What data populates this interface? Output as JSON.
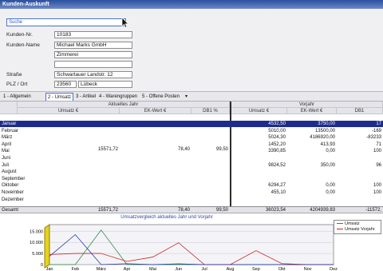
{
  "window": {
    "title": "Kunden-Auskunft"
  },
  "search": {
    "label": "Suche"
  },
  "customer": {
    "nr_label": "Kunden-Nr.",
    "nr": "10183",
    "name_label": "Kunden-Name",
    "name1": "Michael Marks GmbH",
    "name2": "Zimmerei",
    "street_label": "Straße",
    "street": "Schwartauer Landstr. 12",
    "city_label": "PLZ / Ort",
    "zip": "23560",
    "city": "Lübeck"
  },
  "tabs": [
    {
      "label": "1 - Allgemein"
    },
    {
      "label": "2 - Umsatz"
    },
    {
      "label": "3 - Artikel"
    },
    {
      "label": "4 - Warengruppen"
    },
    {
      "label": "5 - Offene Posten"
    }
  ],
  "table": {
    "current_year_label": "Aktuelles Jahr",
    "previous_year_label": "Vorjahr",
    "col_umsatz": "Umsatz €",
    "col_ekwert": "EK-Wert €",
    "col_db": "DB1 %",
    "col_umsatz_prev": "Umsatz €",
    "col_ekwert_prev": "EK-Wert €",
    "col_db_prev": "DB1",
    "months": [
      "Januar",
      "Februar",
      "März",
      "April",
      "Mai",
      "Juni",
      "Juli",
      "August",
      "September",
      "Oktober",
      "November",
      "Dezember"
    ],
    "current": {
      "umsatz": "15571,72",
      "ekwert": "78,40",
      "db": "99,50"
    },
    "previous": [
      {
        "umsatz": "4532,50",
        "ekwert": "3750,00",
        "db": "17"
      },
      {
        "umsatz": "5010,00",
        "ekwert": "13500,00",
        "db": "-169"
      },
      {
        "umsatz": "5024,30",
        "ekwert": "4186920,00",
        "db": "-83233"
      },
      {
        "umsatz": "1452,20",
        "ekwert": "413,93",
        "db": "71"
      },
      {
        "umsatz": "3390,85",
        "ekwert": "0,00",
        "db": "100"
      },
      {
        "umsatz": "9824,52",
        "ekwert": "350,00",
        "db": "96"
      },
      {
        "umsatz": "6294,27",
        "ekwert": "0,00",
        "db": "100"
      },
      {
        "umsatz": "455,10",
        "ekwert": "0,00",
        "db": "100"
      }
    ],
    "total_label": "Gesamt",
    "total_current": {
      "umsatz": "15571,72",
      "ekwert": "78,40",
      "db": "99,50"
    },
    "total_previous": {
      "umsatz": "36023,54",
      "ekwert": "4204939,83",
      "db": "-11572,"
    }
  },
  "chart_data": {
    "type": "line",
    "title": "Umsatzvergleich aktuelles Jahr und Vorjahr",
    "categories": [
      "Jan",
      "Feb",
      "März",
      "Apr",
      "Mai",
      "Jun",
      "Jul",
      "Aug",
      "Sep",
      "Okt",
      "Nov",
      "Dez"
    ],
    "series": [
      {
        "name": "Umsatz",
        "color": "#2b8a3e",
        "values": [
          0,
          0,
          15571.72,
          0,
          0,
          0,
          0,
          0,
          0,
          0,
          0,
          0
        ]
      },
      {
        "name": "Umsatz Vorjahr",
        "color": "#cc2222",
        "values": [
          4532.5,
          5010,
          5024.3,
          1452.2,
          3390.85,
          9824.52,
          0,
          0,
          6294.27,
          455.1,
          0,
          0
        ]
      },
      {
        "name": "",
        "color": "#2233aa",
        "values": [
          3750,
          13500,
          0,
          413.93,
          0,
          350,
          0,
          0,
          0,
          0,
          0,
          0
        ]
      }
    ],
    "yticks": [
      "15.000",
      "10.000",
      "5.000",
      "0"
    ],
    "ylim": [
      0,
      18000
    ]
  }
}
